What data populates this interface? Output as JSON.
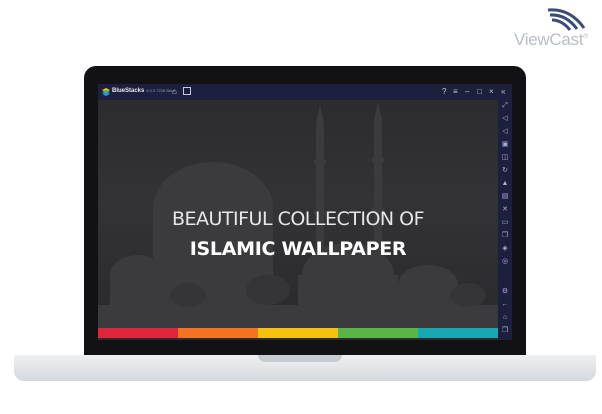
{
  "watermark": {
    "brand": "ViewCast",
    "mark": "®"
  },
  "bluestacks": {
    "app_name": "BlueStacks",
    "version": "5.0.0.7228 Beta"
  },
  "content": {
    "headline_line1": "BEAUTIFUL COLLECTION OF",
    "headline_line2": "ISLAMIC WALLPAPER"
  },
  "stripe_colors": [
    "#e0243c",
    "#f47320",
    "#f7c20f",
    "#59b544",
    "#16a9b3"
  ],
  "sidebar_icons": [
    "fullscreen-icon",
    "volume-up-icon",
    "volume-down-icon",
    "keyboard-icon",
    "screenshot-icon",
    "rotate-icon",
    "shake-icon",
    "macro-icon",
    "apk-icon",
    "folder-icon",
    "multi-instance-icon",
    "eco-mode-icon",
    "location-icon",
    "settings-icon",
    "back-icon",
    "home-icon",
    "recent-apps-icon"
  ]
}
